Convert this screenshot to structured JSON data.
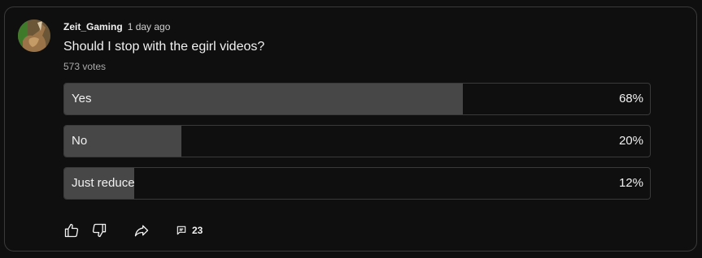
{
  "post": {
    "author": "Zeit_Gaming",
    "time": "1 day ago",
    "question": "Should I stop with the egirl videos?",
    "votes": "573 votes"
  },
  "poll": {
    "options": [
      {
        "label": "Yes",
        "percent_text": "68%",
        "percent": 68
      },
      {
        "label": "No",
        "percent_text": "20%",
        "percent": 20
      },
      {
        "label": "Just reduce",
        "percent_text": "12%",
        "percent": 12
      }
    ]
  },
  "actions": {
    "comments_count": "23"
  },
  "icons": {
    "avatar": "avatar-image",
    "like": "thumbs-up-icon",
    "dislike": "thumbs-down-icon",
    "share": "share-arrow-icon",
    "comments": "comment-icon"
  },
  "colors": {
    "background": "#0f0f0f",
    "border": "#3a3a3a",
    "bar_fill": "#474747",
    "text": "#f1f1f1",
    "muted_text": "#aaaaaa"
  }
}
